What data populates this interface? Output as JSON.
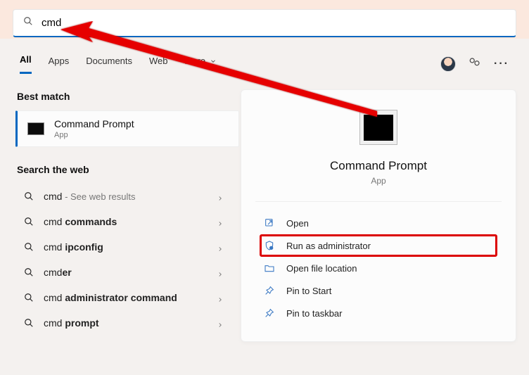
{
  "search": {
    "value": "cmd"
  },
  "tabs": [
    "All",
    "Apps",
    "Documents",
    "Web",
    "More"
  ],
  "activeTab": 0,
  "left": {
    "best_match_label": "Best match",
    "best_match": {
      "title": "Command Prompt",
      "subtitle": "App"
    },
    "search_web_label": "Search the web",
    "web": [
      {
        "prefix": "cmd",
        "bold": "",
        "tail": " - See web results"
      },
      {
        "prefix": "cmd ",
        "bold": "commands",
        "tail": ""
      },
      {
        "prefix": "cmd ",
        "bold": "ipconfig",
        "tail": ""
      },
      {
        "prefix": "cmd",
        "bold": "er",
        "tail": ""
      },
      {
        "prefix": "cmd ",
        "bold": "administrator command",
        "tail": ""
      },
      {
        "prefix": "cmd ",
        "bold": "prompt",
        "tail": ""
      }
    ]
  },
  "right": {
    "title": "Command Prompt",
    "subtitle": "App",
    "actions": [
      {
        "icon": "open",
        "label": "Open",
        "highlight": false
      },
      {
        "icon": "shield",
        "label": "Run as administrator",
        "highlight": true
      },
      {
        "icon": "folder",
        "label": "Open file location",
        "highlight": false
      },
      {
        "icon": "pin",
        "label": "Pin to Start",
        "highlight": false
      },
      {
        "icon": "pin",
        "label": "Pin to taskbar",
        "highlight": false
      }
    ]
  }
}
